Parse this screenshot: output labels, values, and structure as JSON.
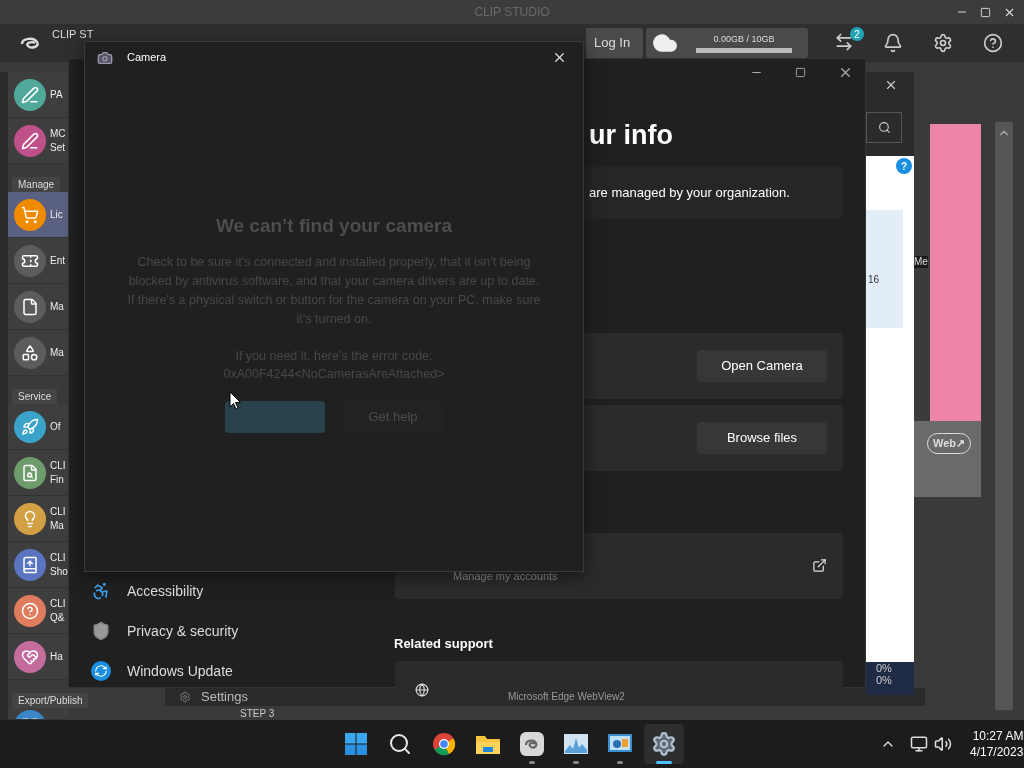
{
  "clip_studio": {
    "title": "CLIP STUDIO",
    "logo_text": "CLIP ST",
    "login": "Log In",
    "storage": "0.00GB / 10GB",
    "sync_badge": "2",
    "sidebar": [
      {
        "kind": "item",
        "lines": [
          "PA"
        ],
        "color": "#4fa89a",
        "selected": false
      },
      {
        "kind": "item",
        "lines": [
          "MC",
          "Set"
        ],
        "color": "#c0508a",
        "selected": false
      },
      {
        "kind": "section",
        "label": "Manage"
      },
      {
        "kind": "item",
        "lines": [
          "Lic"
        ],
        "color": "#f08a00",
        "selected": true
      },
      {
        "kind": "item",
        "lines": [
          "Ent"
        ],
        "color": "#5c5c5c",
        "selected": false
      },
      {
        "kind": "item",
        "lines": [
          "Ma"
        ],
        "color": "#5c5c5c",
        "selected": false
      },
      {
        "kind": "item",
        "lines": [
          "Ma"
        ],
        "color": "#5c5c5c",
        "selected": false
      },
      {
        "kind": "section",
        "label": "Service"
      },
      {
        "kind": "item",
        "lines": [
          "Of"
        ],
        "color": "#3ba3c9",
        "selected": false
      },
      {
        "kind": "item",
        "lines": [
          "CLI",
          "Fin"
        ],
        "color": "#6f9c6c",
        "selected": false
      },
      {
        "kind": "item",
        "lines": [
          "CLI",
          "Ma"
        ],
        "color": "#d4a044",
        "selected": false
      },
      {
        "kind": "item",
        "lines": [
          "CLI",
          "Sho"
        ],
        "color": "#5b74c2",
        "selected": false
      },
      {
        "kind": "item",
        "lines": [
          "CLI",
          "Q&"
        ],
        "color": "#e07c5e",
        "selected": false
      },
      {
        "kind": "item",
        "lines": [
          "Ha"
        ],
        "color": "#c46c9c",
        "selected": false
      },
      {
        "kind": "section",
        "label": "Export/Publish"
      },
      {
        "kind": "item",
        "color": "#3a86c8",
        "selected": false
      }
    ],
    "web_button": "Web↗",
    "side_text": "Me",
    "footer": {
      "settings": "Settings",
      "webview": "Microsoft Edge WebView2",
      "step": "STEP 3"
    }
  },
  "browser_window": {
    "help": "?",
    "cell_text": "16",
    "percents": [
      "0%",
      "0%"
    ]
  },
  "settings_window": {
    "heading": "ur info",
    "org_notice": "are managed by your organization.",
    "buttons": [
      "Open Camera",
      "Browse files"
    ],
    "link_label": "Manage my accounts",
    "related_heading": "Related support",
    "nav": [
      {
        "kind": "accessibility",
        "label": "Accessibility"
      },
      {
        "kind": "privacy",
        "label": "Privacy & security"
      },
      {
        "kind": "update",
        "label": "Windows Update"
      }
    ]
  },
  "camera_dialog": {
    "title": "Camera",
    "heading": "We can’t find your camera",
    "message": "Check to be sure it’s connected and installed properly, that it isn’t being blocked by antivirus software, and that your camera drivers are up to date. If there’s a physical switch or button for the camera on your PC, make sure it’s turned on.",
    "error_intro": "If you need it, here’s the error code:",
    "error_code": "0xA00F4244<NoCamerasAreAttached>",
    "help_button": "Get help"
  },
  "taskbar": {
    "apps": [
      {
        "kind": "start",
        "running": false,
        "selected": false
      },
      {
        "kind": "search",
        "running": false,
        "selected": false
      },
      {
        "kind": "chrome",
        "running": false,
        "selected": false
      },
      {
        "kind": "folder",
        "running": false,
        "selected": false
      },
      {
        "kind": "clip",
        "running": true,
        "selected": false
      },
      {
        "kind": "monitor",
        "running": true,
        "selected": false
      },
      {
        "kind": "remote",
        "running": true,
        "selected": false
      },
      {
        "kind": "settings",
        "running": true,
        "selected": true
      }
    ],
    "time": "10:27 AM",
    "date": "4/17/2023"
  }
}
